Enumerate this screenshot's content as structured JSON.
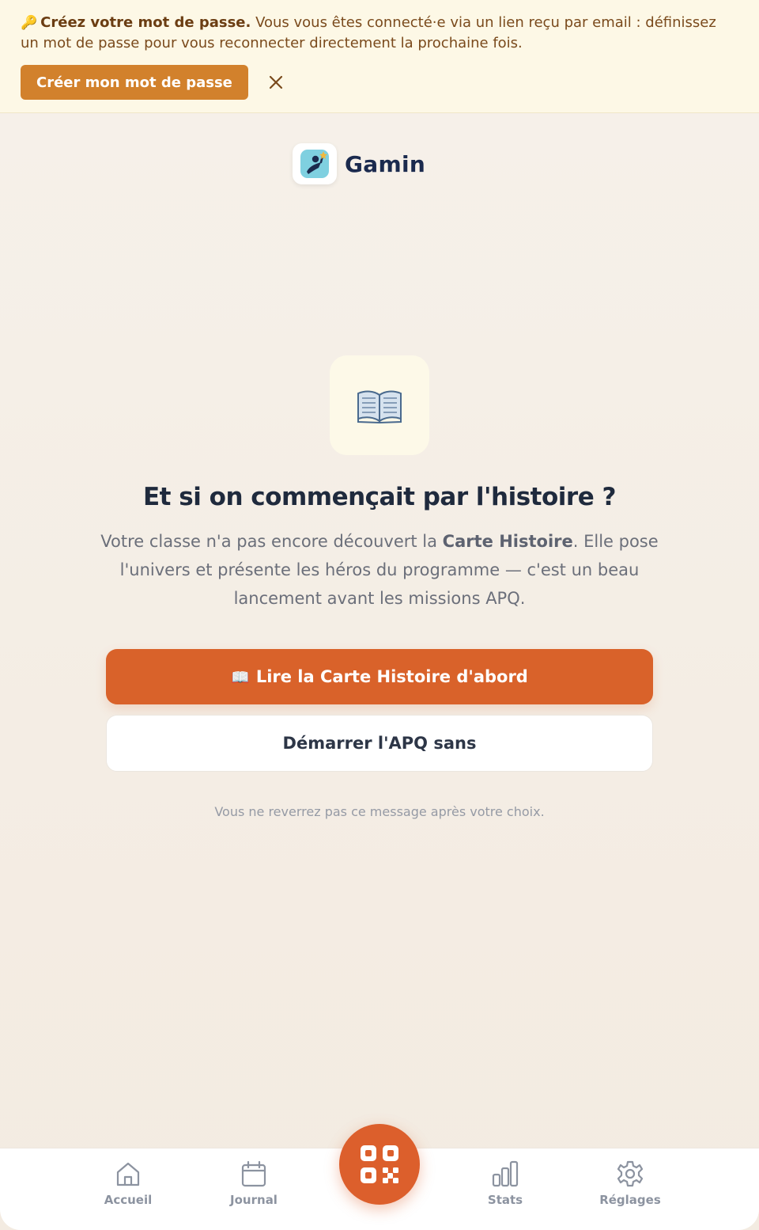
{
  "banner": {
    "title": "Créez votre mot de passe.",
    "message": " Vous vous êtes connecté·e via un lien reçu par email : définissez un mot de passe pour vous reconnecter directement la prochaine fois.",
    "create_button": "Créer mon mot de passe",
    "accent": "#d2812c"
  },
  "logo": {
    "name": "Gamin"
  },
  "main": {
    "heading": "Et si on commençait par l'histoire ?",
    "desc_part1": "Votre classe n'a pas encore découvert la ",
    "desc_bold": "Carte Histoire",
    "desc_part2": ". Elle pose l'univers et présente les héros du programme — c'est un beau lancement avant les missions APQ.",
    "primary_button": "Lire la Carte Histoire d'abord",
    "secondary_button": "Démarrer l'APQ sans",
    "note": "Vous ne reverrez pas ce message après votre choix.",
    "primary_color": "#d9622a"
  },
  "nav": {
    "items": [
      {
        "label": "Accueil",
        "icon": "home-icon"
      },
      {
        "label": "Journal",
        "icon": "calendar-icon"
      },
      {
        "label": "Stats",
        "icon": "bar-chart-icon"
      },
      {
        "label": "Réglages",
        "icon": "gear-icon"
      }
    ],
    "scan_icon": "qr-code-icon"
  }
}
